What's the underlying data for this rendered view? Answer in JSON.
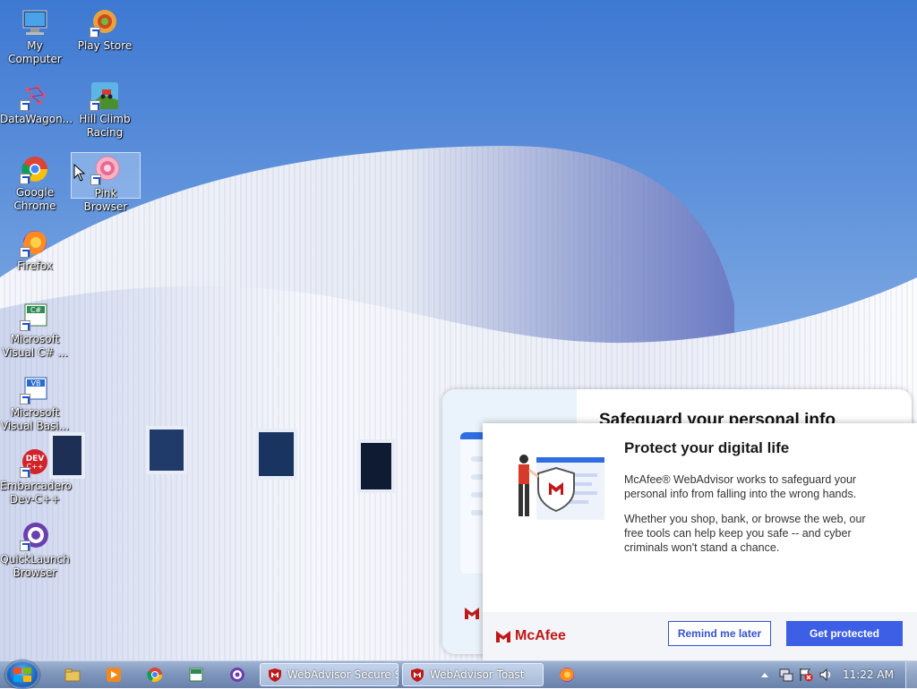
{
  "desktop": {
    "icons": [
      {
        "label": "My Computer"
      },
      {
        "label": "Play Store"
      },
      {
        "label": "DataWagon..."
      },
      {
        "label": "Hill Climb Racing"
      },
      {
        "label": "Google Chrome"
      },
      {
        "label": "Pink Browser"
      },
      {
        "label": "Firefox"
      },
      {
        "label": "Microsoft Visual C# ..."
      },
      {
        "label": "Microsoft Visual Basi..."
      },
      {
        "label": "Embarcadero Dev-C++"
      },
      {
        "label": "QuickLaunch Browser"
      }
    ]
  },
  "background_toast": {
    "title": "Safeguard your personal info"
  },
  "toast": {
    "title": "Protect your digital life",
    "paragraph1": "McAfee® WebAdvisor works to safeguard your personal info from falling into the wrong hands.",
    "paragraph2": "Whether you shop, bank, or browse the web, our free tools can help keep you safe -- and cyber criminals won't stand a chance.",
    "brand": "McAfee",
    "remind_label": "Remind me later",
    "protect_label": "Get protected",
    "accent_color": "#3d5fe6",
    "brand_color": "#c01818"
  },
  "taskbar": {
    "tasks": [
      {
        "label": "WebAdvisor Secure S..."
      },
      {
        "label": "WebAdvisor Toast"
      }
    ],
    "clock": "11:22 AM"
  }
}
